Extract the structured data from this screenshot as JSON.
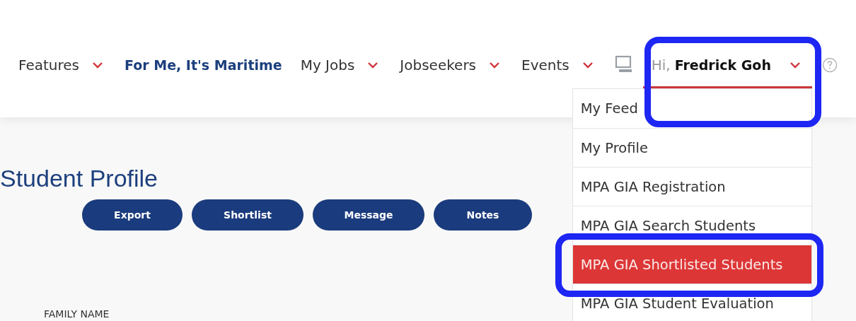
{
  "nav": [
    {
      "label": "Features",
      "kind": "dropdown"
    },
    {
      "label": "For Me, It's Maritime",
      "kind": "highlight"
    },
    {
      "label": "My Jobs",
      "kind": "dropdown"
    },
    {
      "label": "Jobseekers",
      "kind": "dropdown"
    },
    {
      "label": "Events",
      "kind": "dropdown"
    }
  ],
  "user_menu": {
    "greeting": "Hi,",
    "name": "Fredrick Goh",
    "expanded": true,
    "annotated": true
  },
  "dropdown_items": [
    {
      "label": "My Feed",
      "selected": false,
      "annotated": false
    },
    {
      "label": "My Profile",
      "selected": false,
      "annotated": false
    },
    {
      "label": "MPA GIA Registration",
      "selected": false,
      "annotated": false
    },
    {
      "label": "MPA GIA Search Students",
      "selected": false,
      "annotated": false
    },
    {
      "label": "MPA GIA Shortlisted Students",
      "selected": true,
      "annotated": true
    },
    {
      "label": "MPA GIA Student Evaluation",
      "selected": false,
      "annotated": false
    }
  ],
  "page_title": "Student Profile",
  "buttons": [
    "Export",
    "Shortlist",
    "Message",
    "Notes"
  ],
  "field_label": "FAMILY NAME"
}
